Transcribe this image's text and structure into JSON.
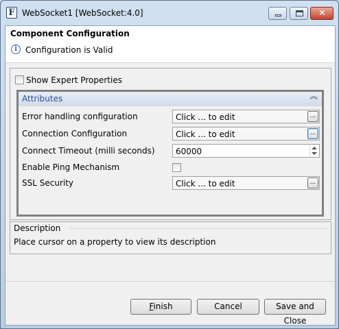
{
  "window": {
    "title": "WebSocket1 [WebSocket:4.0]",
    "app_icon_letter": "F"
  },
  "header": {
    "title": "Component Configuration",
    "status": "Configuration is Valid"
  },
  "options": {
    "show_expert_label": "Show Expert Properties"
  },
  "attributes": {
    "title": "Attributes",
    "rows": [
      {
        "label": "Error handling configuration",
        "value": "Click ... to edit"
      },
      {
        "label": "Connection Configuration",
        "value": "Click ... to edit"
      },
      {
        "label": "Connect Timeout (milli seconds)",
        "value": "60000"
      },
      {
        "label": "Enable Ping Mechanism"
      },
      {
        "label": "SSL Security",
        "value": "Click ... to edit"
      }
    ],
    "ellipsis": "...",
    "collapse_icon": "︽"
  },
  "description": {
    "title": "Description",
    "text": "Place cursor on a property to view its description"
  },
  "buttons": {
    "finish_mnemonic": "F",
    "finish_rest": "inish",
    "cancel": "Cancel",
    "save_close": "Save and Close"
  }
}
